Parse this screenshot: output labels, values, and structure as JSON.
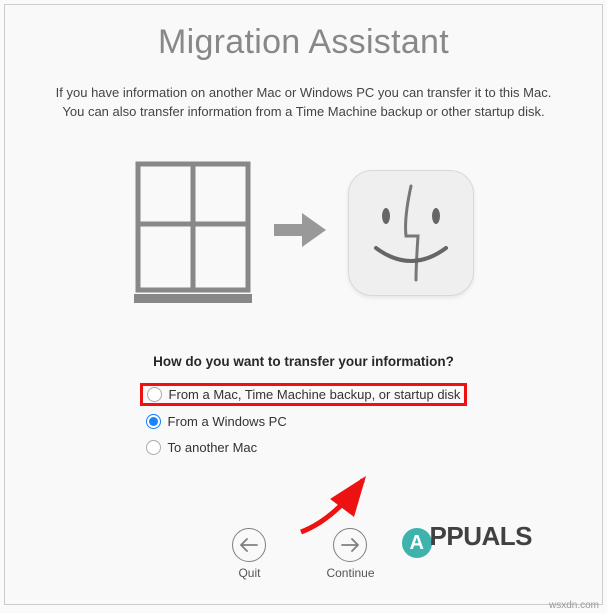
{
  "title": "Migration Assistant",
  "description_line1": "If you have information on another Mac or Windows PC you can transfer it to this Mac.",
  "description_line2": "You can also transfer information from a Time Machine backup or other startup disk.",
  "prompt": "How do you want to transfer your information?",
  "options": [
    {
      "label": "From a Mac, Time Machine backup, or startup disk",
      "selected": false,
      "highlighted": true
    },
    {
      "label": "From a Windows PC",
      "selected": true,
      "highlighted": false
    },
    {
      "label": "To another Mac",
      "selected": false,
      "highlighted": false
    }
  ],
  "buttons": {
    "back": "Quit",
    "continue": "Continue"
  },
  "watermark": {
    "badge": "A",
    "rest": "PPUALS"
  },
  "attribution": "wsxdn.com"
}
